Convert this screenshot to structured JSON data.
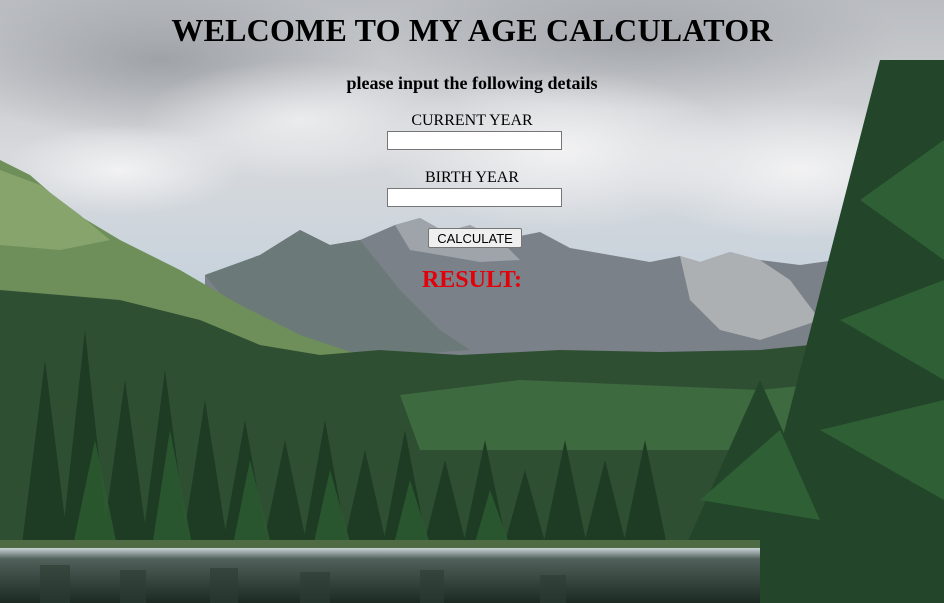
{
  "header": {
    "title": "WELCOME TO MY AGE CALCULATOR",
    "subtitle": "please input the following details"
  },
  "form": {
    "current_year_label": "CURRENT YEAR",
    "current_year_value": "",
    "birth_year_label": "BIRTH YEAR",
    "birth_year_value": "",
    "calculate_label": "CALCULATE"
  },
  "result": {
    "label": "RESULT:"
  },
  "colors": {
    "result_text": "#e3000b"
  }
}
